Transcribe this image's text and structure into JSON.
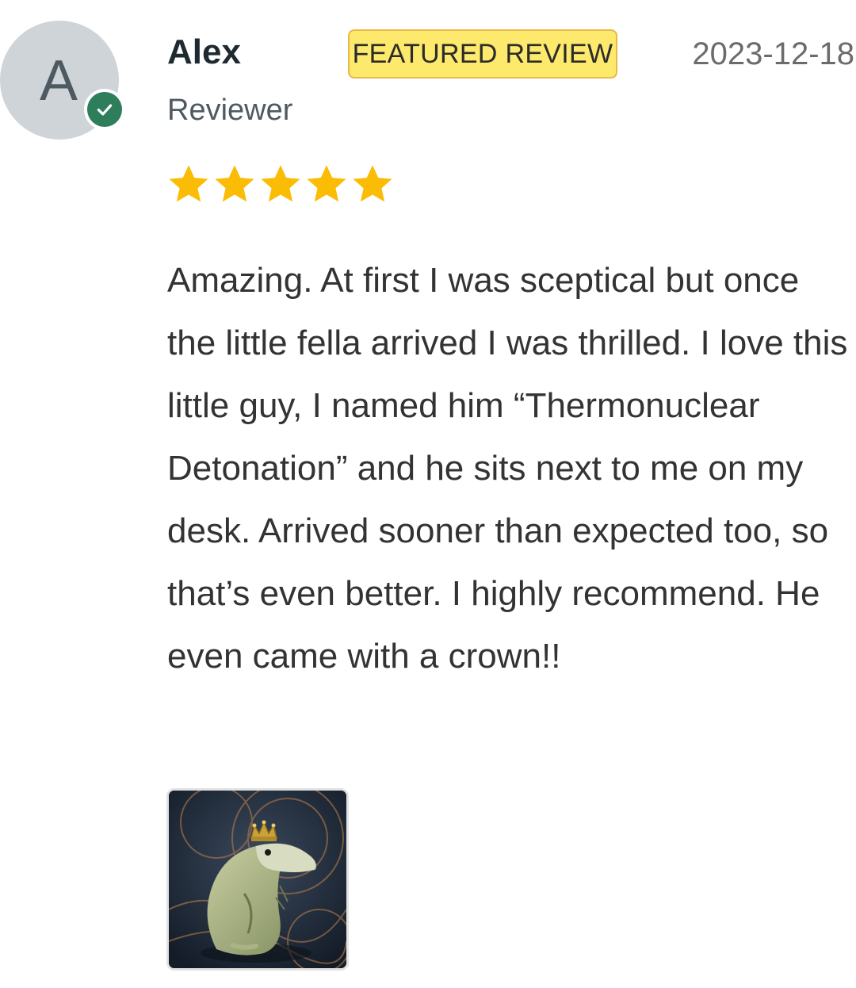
{
  "reviewer": {
    "avatar_initial": "A",
    "name": "Alex",
    "role": "Reviewer",
    "verified": true
  },
  "badge": {
    "label": "FEATURED REVIEW",
    "color": "#fde96b"
  },
  "date": "2023-12-18",
  "rating": {
    "value": 5,
    "max": 5,
    "star_color": "#fbbc05"
  },
  "review_text": "Amazing. At first I was sceptical but once the little fella arrived I was thrilled. I love this little guy, I named him “Thermonuclear Detonation” and he sits next to me on my desk. Arrived sooner than expected too, so that’s even better. I highly recommend. He even came with a crown!!",
  "photos": [
    {
      "description_icon": "crocodile-figurine-with-crown-photo"
    }
  ],
  "colors": {
    "verified_green": "#2e7d5b",
    "avatar_bg": "#cfd4d8"
  }
}
